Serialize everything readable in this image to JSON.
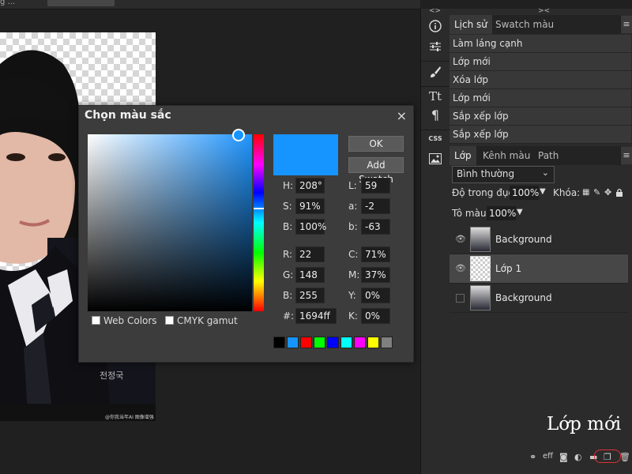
{
  "top_bar": {
    "left_text": "g ...",
    "tab_text": ""
  },
  "toolbar": {
    "collapse_label": "<>",
    "tools": [
      "info-icon",
      "sliders-icon",
      "brush-icon",
      "text-icon",
      "paragraph-icon",
      "css-icon",
      "image-icon"
    ],
    "css_label": "CSS",
    "text_glyph": "Tt",
    "paragraph_glyph": "¶"
  },
  "history_panel": {
    "collapse_label": "><",
    "tabs": [
      {
        "label": "Lịch sử",
        "active": true
      },
      {
        "label": "Swatch màu",
        "active": false
      }
    ],
    "items": [
      "Làm láng cạnh",
      "Lớp mới",
      "Xóa lớp",
      "Lớp mới",
      "Sắp xếp lớp",
      "Sắp xếp lớp"
    ]
  },
  "layers_panel": {
    "tabs": [
      {
        "label": "Lớp",
        "active": true
      },
      {
        "label": "Kênh màu",
        "active": false
      },
      {
        "label": "Path",
        "active": false
      }
    ],
    "blend_mode": "Bình thường",
    "opacity_label": "Độ trong đục:",
    "opacity_value": "100%",
    "lock_label": "Khóa:",
    "fill_label": "Tô màu:",
    "fill_value": "100%",
    "layers": [
      {
        "name": "Background",
        "visible": true,
        "selected": false
      },
      {
        "name": "Lớp 1",
        "visible": true,
        "selected": true
      },
      {
        "name": "Background",
        "visible": false,
        "selected": false
      }
    ]
  },
  "color_picker": {
    "title": "Chọn màu sắc",
    "close": "×",
    "current_color": "#1694ff",
    "ok_label": "OK",
    "add_swatch_label": "Add Swatch",
    "fields": {
      "H": "208°",
      "S": "91%",
      "B": "100%",
      "L": "59",
      "a": "-2",
      "b": "-63",
      "R": "22",
      "G": "148",
      "B2": "255",
      "C": "71%",
      "M": "37%",
      "Y": "0%",
      "K": "0%",
      "hex": "1694ff"
    },
    "labels": {
      "H": "H:",
      "S": "S:",
      "B": "B:",
      "L": "L:",
      "a": "a:",
      "b": "b:",
      "R": "R:",
      "G": "G:",
      "B2": "B:",
      "C": "C:",
      "M": "M:",
      "Y": "Y:",
      "K": "K:",
      "hex": "#:"
    },
    "web_colors_label": "Web Colors",
    "cmyk_gamut_label": "CMYK gamut",
    "swatches": [
      "#000000",
      "#1694ff",
      "#ff0000",
      "#00ff00",
      "#0000ff",
      "#00ffff",
      "#ff00ff",
      "#ffff00",
      "#808080"
    ]
  },
  "bottom_icons": [
    "link-icon",
    "effects-icon",
    "mask-icon",
    "adjustment-icon",
    "folder-icon",
    "new-layer-icon",
    "trash-icon"
  ],
  "effects_label": "eff",
  "caption": "Lớp mới",
  "canvas_watermark": "전정국",
  "canvas_credit": "@你我当年AI 图像增强"
}
